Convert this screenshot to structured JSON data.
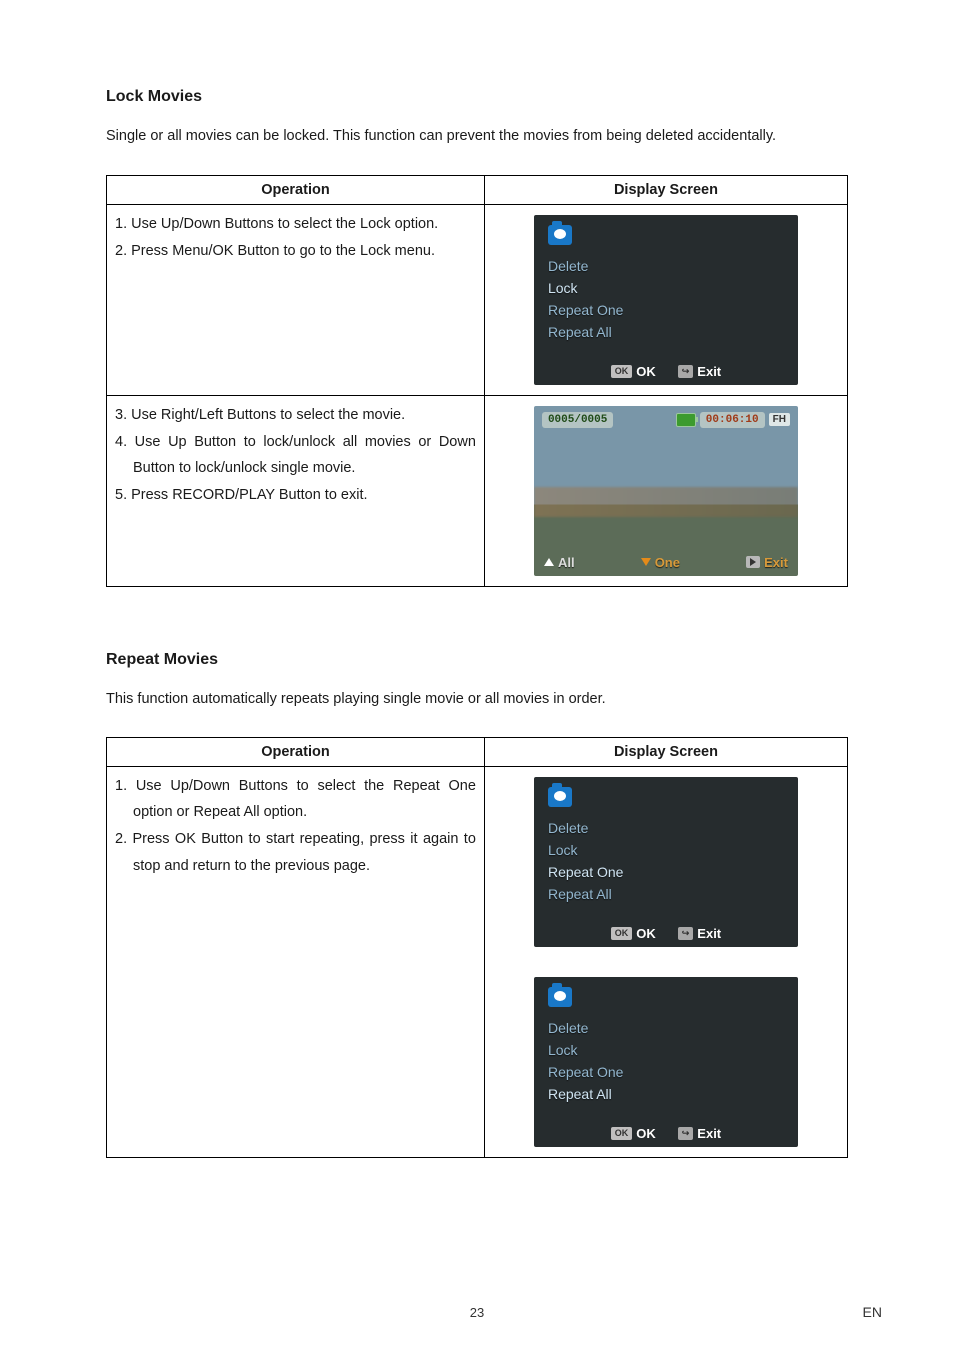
{
  "sections": {
    "lock": {
      "heading": "Lock Movies",
      "intro": "Single or all movies can be locked. This function can prevent the movies from being deleted accidentally."
    },
    "repeat": {
      "heading": "Repeat Movies",
      "intro": "This function automatically repeats playing single movie or all movies in order."
    }
  },
  "table_headers": {
    "operation": "Operation",
    "display_screen": "Display Screen"
  },
  "lock_table": {
    "row1": {
      "step1": "1. Use Up/Down Buttons to select the Lock option.",
      "step2": "2. Press Menu/OK Button to go to the Lock menu."
    },
    "row2": {
      "step3": "3. Use Right/Left Buttons to select the movie.",
      "step4": "4. Use Up Button to lock/unlock all movies or Down Button to lock/unlock single movie.",
      "step5": "5. Press RECORD/PLAY Button to exit."
    }
  },
  "repeat_table": {
    "row1": {
      "step1": "1. Use Up/Down Buttons to select the Repeat One option or Repeat All option.",
      "step2": "2. Press OK Button to start repeating, press it again to stop and return to the previous page."
    }
  },
  "cam_menu": {
    "items": [
      "Delete",
      "Lock",
      "Repeat One",
      "Repeat All"
    ],
    "ok_chip": "OK",
    "ok_label": "OK",
    "exit_chip": "↪",
    "exit_label": "Exit"
  },
  "playback": {
    "counter": "0005/0005",
    "time": "00:06:10",
    "fh": "FH",
    "all": "All",
    "one": "One",
    "exit": "Exit"
  },
  "footer": {
    "page_no": "23",
    "lang": "EN"
  }
}
